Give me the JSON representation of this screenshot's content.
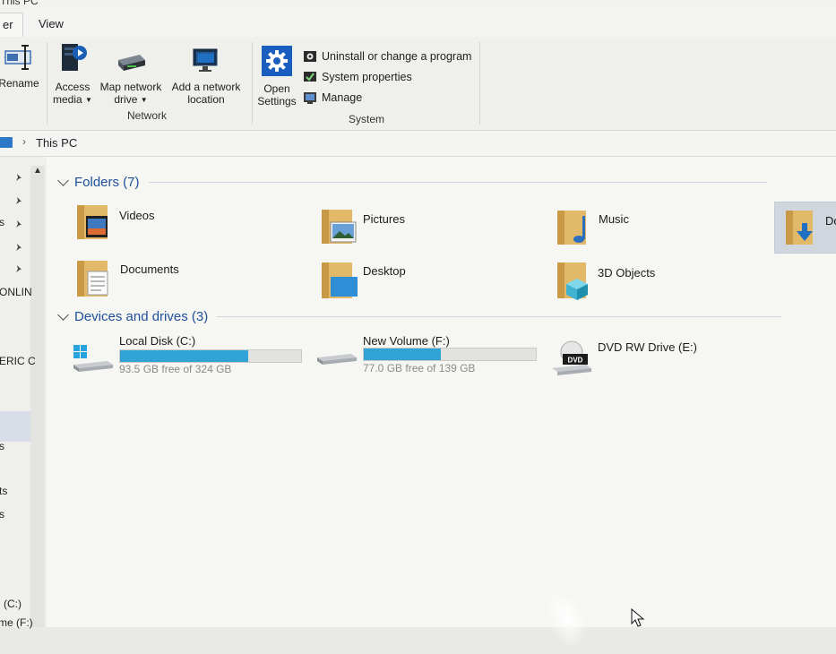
{
  "window": {
    "title": "This PC"
  },
  "tabs": [
    {
      "label": "er"
    },
    {
      "label": "View"
    }
  ],
  "ribbon": {
    "rename_label": "Rename",
    "network": {
      "access_media": "Access\nmedia",
      "map_network_drive": "Map network\ndrive",
      "add_network_location": "Add a network\nlocation",
      "group_label": "Network"
    },
    "system": {
      "open_settings": "Open\nSettings",
      "uninstall": "Uninstall or change a program",
      "system_properties": "System properties",
      "manage": "Manage",
      "group_label": "System"
    }
  },
  "address": {
    "crumb": "This PC"
  },
  "nav": {
    "fragments": [
      "s",
      "ONLIN",
      "ERIC C",
      "s",
      "ts",
      "s",
      "(C:)",
      "me (F:)"
    ]
  },
  "folders": {
    "header": "Folders (7)",
    "items": [
      {
        "label": "Videos",
        "icon": "videos-folder-icon"
      },
      {
        "label": "Pictures",
        "icon": "pictures-folder-icon"
      },
      {
        "label": "Music",
        "icon": "music-folder-icon"
      },
      {
        "label": "Do",
        "icon": "downloads-folder-icon"
      },
      {
        "label": "Documents",
        "icon": "documents-folder-icon"
      },
      {
        "label": "Desktop",
        "icon": "desktop-folder-icon"
      },
      {
        "label": "3D Objects",
        "icon": "3d-objects-folder-icon"
      }
    ]
  },
  "devices": {
    "header": "Devices and drives (3)",
    "drives": [
      {
        "label": "Local Disk (C:)",
        "free_text": "93.5 GB free of 324 GB",
        "used_fraction": 0.71
      },
      {
        "label": "New Volume (F:)",
        "free_text": "77.0 GB free of 139 GB",
        "used_fraction": 0.45
      },
      {
        "label": "DVD RW Drive (E:)",
        "icon_text": "DVD"
      }
    ]
  },
  "colors": {
    "accent": "#1f4f9a",
    "drive_bar": "#32a3d6"
  }
}
